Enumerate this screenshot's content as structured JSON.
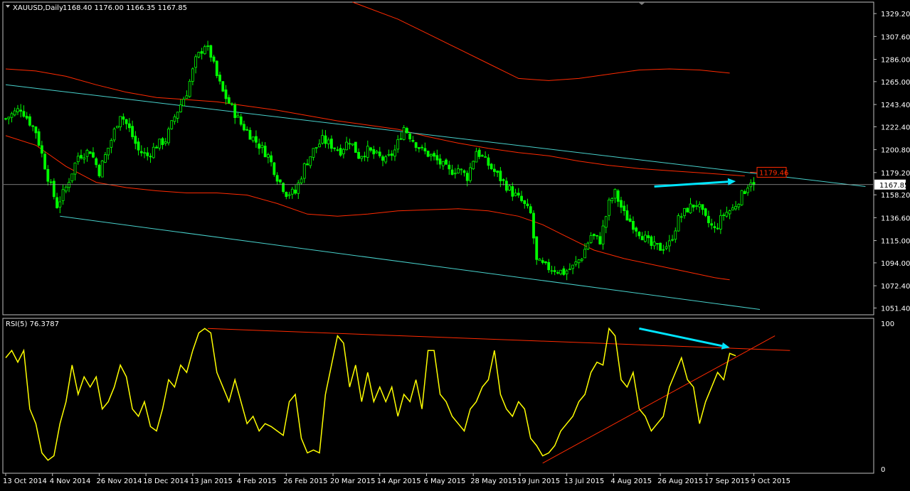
{
  "window": {
    "symbol_label": "XAUUSD,Daily",
    "ohlc_label": "1168.40 1176.00 1166.35 1167.85",
    "current_price_label": "1167.85",
    "level_label": "1179.46"
  },
  "rsi": {
    "label": "RSI(5) 76.3787",
    "scale_top": "100",
    "scale_bottom": "0"
  },
  "colors": {
    "background": "#000000",
    "border": "#c0c0c0",
    "candles": "#00ff00",
    "envelopes": "#ff2a00",
    "channel": "#48d1cc",
    "annotation_arrow": "#00e5ff",
    "rsi_line": "#ffff00",
    "trendline": "#ff2a00",
    "text": "#ffffff"
  },
  "chart_data": [
    {
      "type": "candlestick",
      "title": "XAUUSD,Daily",
      "subtitle": "1168.40 1176.00 1166.35 1167.85",
      "xlabel": "",
      "ylabel": "",
      "ylim": [
        1045,
        1340
      ],
      "grid": false,
      "y_ticks": [
        1329.2,
        1307.6,
        1286.0,
        1265.0,
        1243.4,
        1222.4,
        1200.8,
        1179.2,
        1158.2,
        1136.6,
        1115.0,
        1094.0,
        1072.4,
        1051.4
      ],
      "x_ticks": [
        "13 Oct 2014",
        "4 Nov 2014",
        "26 Nov 2014",
        "18 Dec 2014",
        "13 Jan 2015",
        "4 Feb 2015",
        "26 Feb 2015",
        "20 Mar 2015",
        "14 Apr 2015",
        "6 May 2015",
        "28 May 2015",
        "19 Jun 2015",
        "13 Jul 2015",
        "4 Aug 2015",
        "26 Aug 2015",
        "17 Sep 2015",
        "9 Oct 2015"
      ],
      "close_anchors": [
        [
          0,
          1230
        ],
        [
          5,
          1240
        ],
        [
          10,
          1218
        ],
        [
          14,
          1175
        ],
        [
          17,
          1148
        ],
        [
          20,
          1165
        ],
        [
          24,
          1195
        ],
        [
          28,
          1200
        ],
        [
          31,
          1180
        ],
        [
          35,
          1210
        ],
        [
          38,
          1235
        ],
        [
          41,
          1220
        ],
        [
          44,
          1200
        ],
        [
          47,
          1195
        ],
        [
          50,
          1205
        ],
        [
          53,
          1210
        ],
        [
          56,
          1232
        ],
        [
          60,
          1255
        ],
        [
          63,
          1285
        ],
        [
          66,
          1300
        ],
        [
          68,
          1290
        ],
        [
          70,
          1270
        ],
        [
          72,
          1255
        ],
        [
          75,
          1240
        ],
        [
          78,
          1225
        ],
        [
          81,
          1215
        ],
        [
          84,
          1205
        ],
        [
          87,
          1195
        ],
        [
          90,
          1175
        ],
        [
          93,
          1160
        ],
        [
          96,
          1160
        ],
        [
          99,
          1185
        ],
        [
          102,
          1200
        ],
        [
          105,
          1210
        ],
        [
          108,
          1205
        ],
        [
          111,
          1200
        ],
        [
          114,
          1210
        ],
        [
          117,
          1195
        ],
        [
          120,
          1200
        ],
        [
          123,
          1195
        ],
        [
          126,
          1190
        ],
        [
          129,
          1200
        ],
        [
          132,
          1222
        ],
        [
          135,
          1210
        ],
        [
          138,
          1200
        ],
        [
          141,
          1195
        ],
        [
          144,
          1188
        ],
        [
          147,
          1180
        ],
        [
          150,
          1183
        ],
        [
          153,
          1175
        ],
        [
          156,
          1200
        ],
        [
          159,
          1190
        ],
        [
          162,
          1180
        ],
        [
          165,
          1170
        ],
        [
          168,
          1160
        ],
        [
          171,
          1152
        ],
        [
          174,
          1140
        ],
        [
          176,
          1095
        ],
        [
          179,
          1090
        ],
        [
          182,
          1088
        ],
        [
          185,
          1085
        ],
        [
          188,
          1090
        ],
        [
          191,
          1100
        ],
        [
          194,
          1120
        ],
        [
          197,
          1115
        ],
        [
          200,
          1150
        ],
        [
          202,
          1160
        ],
        [
          205,
          1140
        ],
        [
          208,
          1130
        ],
        [
          211,
          1120
        ],
        [
          214,
          1110
        ],
        [
          217,
          1108
        ],
        [
          220,
          1112
        ],
        [
          223,
          1135
        ],
        [
          226,
          1145
        ],
        [
          229,
          1150
        ],
        [
          232,
          1135
        ],
        [
          235,
          1125
        ],
        [
          238,
          1140
        ],
        [
          241,
          1145
        ],
        [
          244,
          1158
        ],
        [
          247,
          1172
        ],
        [
          248,
          1167.85
        ]
      ],
      "series": [
        {
          "type": "line",
          "values": [
            [
              0,
              1214
            ],
            [
              10,
              1205
            ],
            [
              20,
              1185
            ],
            [
              30,
              1170
            ],
            [
              40,
              1165
            ],
            [
              50,
              1162
            ],
            [
              60,
              1160
            ],
            [
              70,
              1160
            ],
            [
              80,
              1158
            ],
            [
              90,
              1150
            ],
            [
              100,
              1140
            ],
            [
              110,
              1138
            ],
            [
              120,
              1140
            ],
            [
              130,
              1143
            ],
            [
              140,
              1144
            ],
            [
              150,
              1145
            ],
            [
              160,
              1143
            ],
            [
              170,
              1138
            ],
            [
              178,
              1130
            ],
            [
              185,
              1120
            ],
            [
              195,
              1106
            ],
            [
              205,
              1098
            ],
            [
              215,
              1092
            ],
            [
              225,
              1086
            ],
            [
              235,
              1080
            ],
            [
              240,
              1078
            ]
          ]
        },
        {
          "type": "line",
          "values": [
            [
              0,
              1277
            ],
            [
              10,
              1275
            ],
            [
              20,
              1270
            ],
            [
              30,
              1262
            ],
            [
              40,
              1255
            ],
            [
              50,
              1250
            ],
            [
              60,
              1248
            ],
            [
              70,
              1246
            ],
            [
              80,
              1242
            ],
            [
              90,
              1238
            ],
            [
              100,
              1233
            ],
            [
              110,
              1228
            ],
            [
              120,
              1224
            ],
            [
              130,
              1220
            ],
            [
              140,
              1213
            ],
            [
              150,
              1207
            ],
            [
              160,
              1202
            ],
            [
              170,
              1198
            ],
            [
              180,
              1195
            ],
            [
              190,
              1190
            ],
            [
              200,
              1186
            ],
            [
              210,
              1183
            ],
            [
              220,
              1181
            ],
            [
              230,
              1179
            ],
            [
              240,
              1177
            ],
            [
              245,
              1176
            ]
          ]
        },
        {
          "type": "line",
          "values": [
            [
              115,
              1340
            ],
            [
              130,
              1324
            ],
            [
              140,
              1310
            ],
            [
              150,
              1296
            ],
            [
              160,
              1282
            ],
            [
              170,
              1268
            ],
            [
              180,
              1266
            ],
            [
              190,
              1268
            ],
            [
              200,
              1272
            ],
            [
              210,
              1276
            ],
            [
              220,
              1277
            ],
            [
              230,
              1276
            ],
            [
              240,
              1273
            ]
          ]
        },
        {
          "type": "line",
          "values": [
            [
              0,
              1262
            ],
            [
              285,
              1166
            ]
          ]
        },
        {
          "type": "line",
          "values": [
            [
              18,
              1138
            ],
            [
              250,
              1050
            ]
          ]
        },
        {
          "type": "line",
          "values": [
            [
              215,
              1166
            ],
            [
              242,
              1171
            ]
          ]
        }
      ]
    },
    {
      "type": "line",
      "title": "RSI(5) 76.3787",
      "xlabel": "",
      "ylabel": "",
      "ylim": [
        0,
        100
      ],
      "grid": false,
      "y_ticks": [
        100,
        0
      ],
      "values": [
        [
          0,
          75
        ],
        [
          2,
          80
        ],
        [
          4,
          72
        ],
        [
          6,
          80
        ],
        [
          8,
          40
        ],
        [
          10,
          30
        ],
        [
          12,
          10
        ],
        [
          14,
          5
        ],
        [
          16,
          8
        ],
        [
          18,
          30
        ],
        [
          20,
          45
        ],
        [
          22,
          70
        ],
        [
          24,
          50
        ],
        [
          26,
          62
        ],
        [
          28,
          55
        ],
        [
          30,
          62
        ],
        [
          32,
          40
        ],
        [
          34,
          45
        ],
        [
          36,
          55
        ],
        [
          38,
          70
        ],
        [
          40,
          62
        ],
        [
          42,
          40
        ],
        [
          44,
          35
        ],
        [
          46,
          45
        ],
        [
          48,
          28
        ],
        [
          50,
          25
        ],
        [
          52,
          40
        ],
        [
          54,
          60
        ],
        [
          56,
          55
        ],
        [
          58,
          70
        ],
        [
          60,
          65
        ],
        [
          62,
          80
        ],
        [
          64,
          92
        ],
        [
          66,
          95
        ],
        [
          68,
          92
        ],
        [
          70,
          65
        ],
        [
          72,
          55
        ],
        [
          74,
          45
        ],
        [
          76,
          60
        ],
        [
          78,
          45
        ],
        [
          80,
          30
        ],
        [
          82,
          35
        ],
        [
          84,
          25
        ],
        [
          86,
          30
        ],
        [
          88,
          28
        ],
        [
          90,
          25
        ],
        [
          92,
          22
        ],
        [
          94,
          45
        ],
        [
          96,
          50
        ],
        [
          98,
          20
        ],
        [
          100,
          10
        ],
        [
          102,
          12
        ],
        [
          104,
          10
        ],
        [
          106,
          50
        ],
        [
          108,
          70
        ],
        [
          110,
          90
        ],
        [
          112,
          85
        ],
        [
          114,
          55
        ],
        [
          116,
          70
        ],
        [
          118,
          45
        ],
        [
          120,
          65
        ],
        [
          122,
          45
        ],
        [
          124,
          55
        ],
        [
          126,
          45
        ],
        [
          128,
          55
        ],
        [
          130,
          35
        ],
        [
          132,
          50
        ],
        [
          134,
          45
        ],
        [
          136,
          60
        ],
        [
          138,
          40
        ],
        [
          140,
          80
        ],
        [
          142,
          80
        ],
        [
          144,
          50
        ],
        [
          146,
          45
        ],
        [
          148,
          35
        ],
        [
          150,
          30
        ],
        [
          152,
          25
        ],
        [
          154,
          40
        ],
        [
          156,
          45
        ],
        [
          158,
          55
        ],
        [
          160,
          60
        ],
        [
          162,
          80
        ],
        [
          164,
          50
        ],
        [
          166,
          40
        ],
        [
          168,
          35
        ],
        [
          170,
          45
        ],
        [
          172,
          40
        ],
        [
          174,
          20
        ],
        [
          176,
          15
        ],
        [
          178,
          8
        ],
        [
          180,
          10
        ],
        [
          182,
          15
        ],
        [
          184,
          25
        ],
        [
          186,
          30
        ],
        [
          188,
          35
        ],
        [
          190,
          45
        ],
        [
          192,
          50
        ],
        [
          194,
          65
        ],
        [
          196,
          72
        ],
        [
          198,
          70
        ],
        [
          200,
          95
        ],
        [
          202,
          90
        ],
        [
          204,
          60
        ],
        [
          206,
          55
        ],
        [
          208,
          65
        ],
        [
          210,
          40
        ],
        [
          212,
          35
        ],
        [
          214,
          25
        ],
        [
          216,
          30
        ],
        [
          218,
          35
        ],
        [
          220,
          55
        ],
        [
          222,
          65
        ],
        [
          224,
          75
        ],
        [
          226,
          60
        ],
        [
          228,
          55
        ],
        [
          230,
          30
        ],
        [
          232,
          45
        ],
        [
          234,
          55
        ],
        [
          236,
          65
        ],
        [
          238,
          60
        ],
        [
          240,
          78
        ],
        [
          242,
          76.38
        ]
      ],
      "series": [
        {
          "type": "line",
          "values": [
            [
              67,
              95
            ],
            [
              260,
              80
            ]
          ]
        },
        {
          "type": "line",
          "values": [
            [
              178,
              3
            ],
            [
              255,
              90
            ]
          ]
        },
        {
          "type": "line",
          "values": [
            [
              210,
              95
            ],
            [
              240,
              82
            ]
          ]
        }
      ]
    }
  ]
}
